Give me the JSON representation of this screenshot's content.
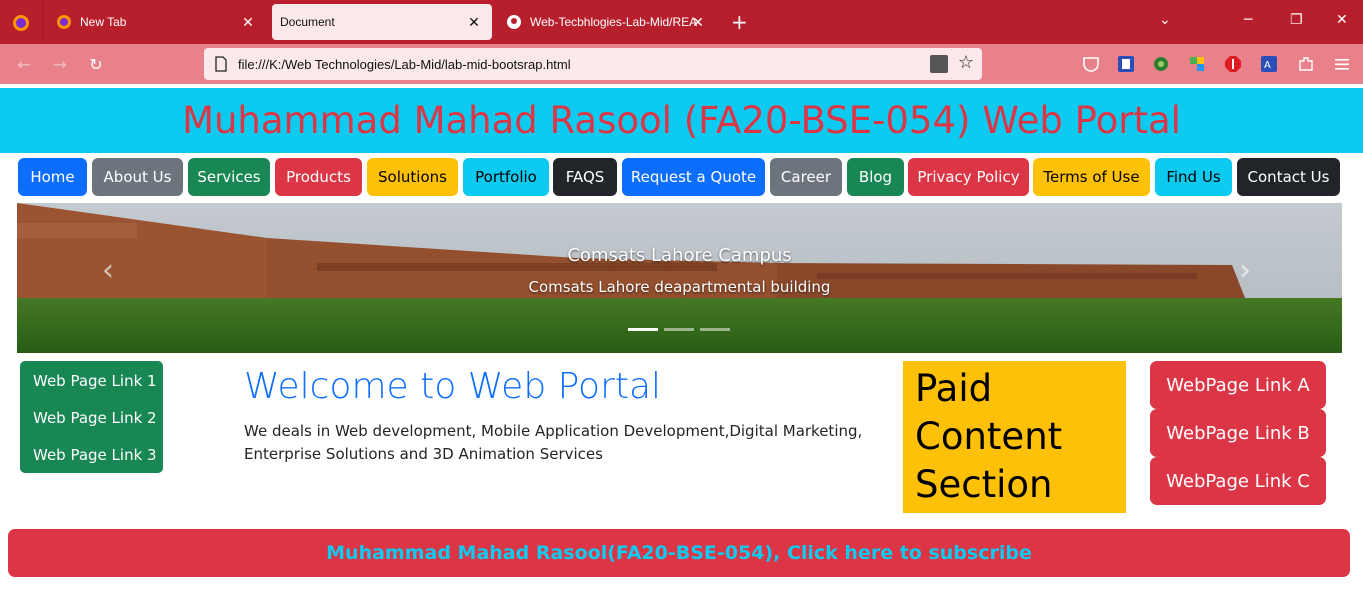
{
  "browser": {
    "tabs": [
      {
        "title": "New Tab",
        "icon": "firefox-icon",
        "active": false
      },
      {
        "title": "Document",
        "icon": "",
        "active": true
      },
      {
        "title": "Web-Tecbhlogies-Lab-Mid/REA",
        "icon": "github-icon",
        "active": false
      }
    ],
    "new_tab_symbol": "+",
    "url": "file:///K:/Web Technologies/Lab-Mid/lab-mid-bootsrap.html",
    "colors": {
      "tabbar": "#b81f2c",
      "toolbar": "#e9818b",
      "urlbar": "#fbe8ea"
    }
  },
  "page": {
    "header_title": "Muhammad Mahad Rasool (FA20-BSE-054) Web Portal",
    "nav": [
      {
        "label": "Home",
        "color": "#0d6efd",
        "text": "#ffffff"
      },
      {
        "label": "About Us",
        "color": "#6c757d",
        "text": "#ffffff"
      },
      {
        "label": "Services",
        "color": "#198754",
        "text": "#ffffff"
      },
      {
        "label": "Products",
        "color": "#dc3545",
        "text": "#ffffff"
      },
      {
        "label": "Solutions",
        "color": "#ffc107",
        "text": "#000000"
      },
      {
        "label": "Portfolio",
        "color": "#0dcaf0",
        "text": "#000000"
      },
      {
        "label": "FAQS",
        "color": "#212529",
        "text": "#ffffff"
      },
      {
        "label": "Request a Quote",
        "color": "#0d6efd",
        "text": "#ffffff"
      },
      {
        "label": "Career",
        "color": "#6c757d",
        "text": "#ffffff"
      },
      {
        "label": "Blog",
        "color": "#198754",
        "text": "#ffffff"
      },
      {
        "label": "Privacy Policy",
        "color": "#dc3545",
        "text": "#ffffff"
      },
      {
        "label": "Terms of Use",
        "color": "#ffc107",
        "text": "#000000"
      },
      {
        "label": "Find Us",
        "color": "#0dcaf0",
        "text": "#000000"
      },
      {
        "label": "Contact Us",
        "color": "#212529",
        "text": "#ffffff"
      }
    ],
    "carousel": {
      "title": "Comsats Lahore Campus",
      "subtitle": "Comsats Lahore deapartmental building",
      "prev": "‹",
      "next": "›",
      "slide_count": 3,
      "active_slide": 1
    },
    "side_links": [
      "Web Page Link 1",
      "Web Page Link 2",
      "Web Page Link 3"
    ],
    "welcome_title": "Welcome to Web Portal",
    "welcome_text": "We deals in Web development, Mobile Application Development,Digital Marketing, Enterprise Solutions and 3D Animation Services",
    "paid_lines": [
      "Paid",
      "Content",
      "Section"
    ],
    "right_links": [
      "WebPage Link A",
      "WebPage Link B",
      "WebPage Link C"
    ],
    "subscribe_label": "Muhammad Mahad Rasool(FA20-BSE-054), Click here to subscribe"
  }
}
